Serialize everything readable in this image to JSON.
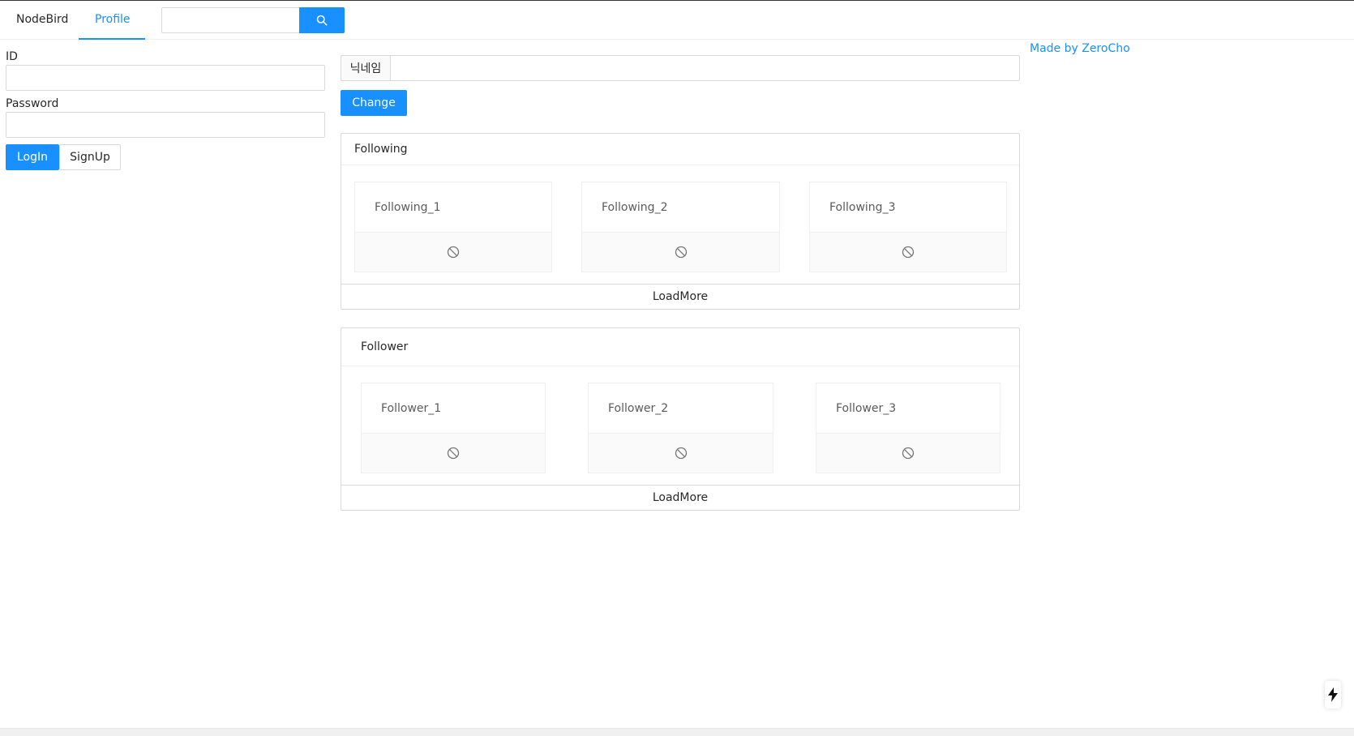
{
  "nav": {
    "home_label": "NodeBird",
    "profile_label": "Profile",
    "search": {
      "value": "",
      "placeholder": ""
    }
  },
  "login": {
    "id_label": "ID",
    "id_value": "",
    "password_label": "Password",
    "password_value": "",
    "login_button": "LogIn",
    "signup_button": "SignUp"
  },
  "nickname": {
    "addon_label": "닉네임",
    "value": "",
    "change_button": "Change"
  },
  "following": {
    "title": "Following",
    "items": [
      "Following_1",
      "Following_2",
      "Following_3"
    ],
    "load_more": "LoadMore"
  },
  "follower": {
    "title": "Follower",
    "items": [
      "Follower_1",
      "Follower_2",
      "Follower_3"
    ],
    "load_more": "LoadMore"
  },
  "footer_link": "Made by ZeroCho",
  "icons": {
    "search": "search-icon",
    "block": "stop-icon",
    "bolt": "lightning-icon"
  },
  "colors": {
    "primary": "#1890ff",
    "border": "#d9d9d9",
    "card_footer": "#fafafa"
  }
}
